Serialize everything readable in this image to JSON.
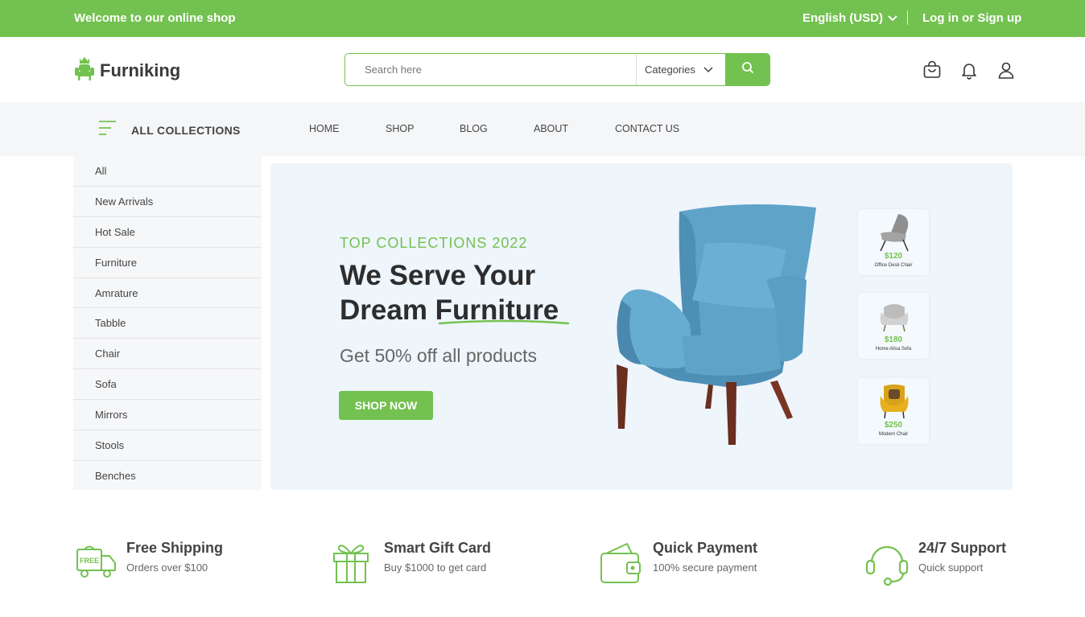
{
  "topbar": {
    "welcome": "Welcome to our online shop",
    "language": "English (USD)",
    "auth": "Log in or Sign up"
  },
  "header": {
    "logo_text": "Furniking",
    "search_placeholder": "Search here",
    "category_label": "Categories",
    "icons": [
      "cart-icon",
      "bell-icon",
      "user-icon"
    ]
  },
  "nav": {
    "all_collections": "ALL COLLECTIONS",
    "links": [
      "HOME",
      "SHOP",
      "BLOG",
      "ABOUT",
      "CONTACT US"
    ]
  },
  "sidebar": {
    "items": [
      "All",
      "New Arrivals",
      "Hot Sale",
      "Furniture",
      "Amrature",
      "Tabble",
      "Chair",
      "Sofa",
      "Mirrors",
      "Stools",
      "Benches"
    ]
  },
  "hero": {
    "eyebrow": "TOP COLLECTIONS 2022",
    "headline_line1": "We Serve Your",
    "headline_line2a": "Dream ",
    "headline_line2b": "Furniture",
    "subtitle": "Get 50% off all products",
    "cta": "SHOP NOW",
    "thumbs": [
      {
        "price": "$120",
        "name": "Office Desk Chair"
      },
      {
        "price": "$180",
        "name": "Home Alisa Sofa"
      },
      {
        "price": "$250",
        "name": "Modern Chair"
      }
    ]
  },
  "features": [
    {
      "title": "Free Shipping",
      "subtitle": "Orders over $100",
      "icon": "truck-icon"
    },
    {
      "title": "Smart Gift Card",
      "subtitle": "Buy $1000 to get card",
      "icon": "gift-icon"
    },
    {
      "title": "Quick Payment",
      "subtitle": "100% secure payment",
      "icon": "wallet-icon"
    },
    {
      "title": "24/7 Support",
      "subtitle": "Quick support",
      "icon": "headset-icon"
    }
  ],
  "colors": {
    "brand": "#73c150",
    "hero_bg": "#eef5fb",
    "chair_blue": "#5fa3c9"
  }
}
